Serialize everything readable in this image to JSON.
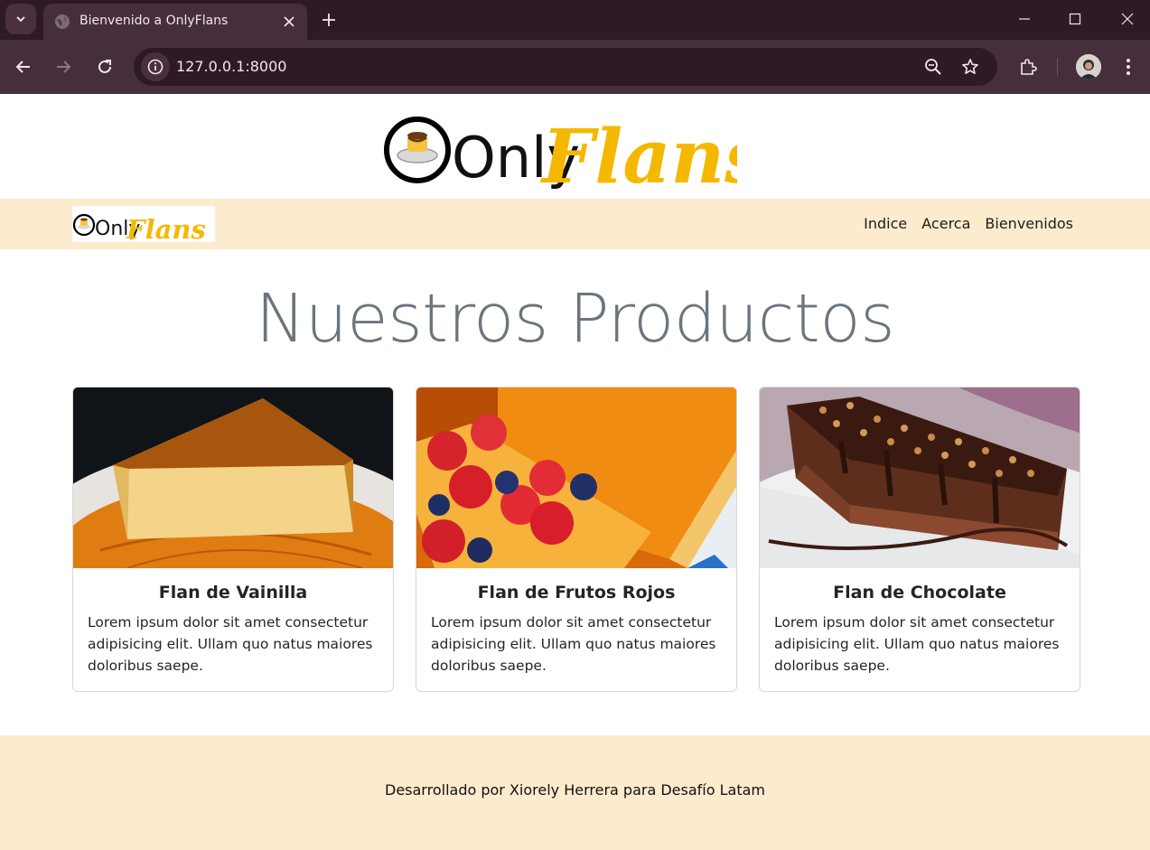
{
  "browser": {
    "tab_title": "Bienvenido a OnlyFlans",
    "url": "127.0.0.1:8000"
  },
  "brand": {
    "logo_text_1": "Only",
    "logo_text_2": "Flans",
    "accent_color": "#f5b800",
    "navbar_bg": "#fdebcd"
  },
  "nav": {
    "links": [
      "Indice",
      "Acerca",
      "Bienvenidos"
    ]
  },
  "main": {
    "heading": "Nuestros Productos",
    "cards": [
      {
        "title": "Flan de Vainilla",
        "text": "Lorem ipsum dolor sit amet consectetur adipisicing elit. Ullam quo natus maiores doloribus saepe."
      },
      {
        "title": "Flan de Frutos Rojos",
        "text": "Lorem ipsum dolor sit amet consectetur adipisicing elit. Ullam quo natus maiores doloribus saepe."
      },
      {
        "title": "Flan de Chocolate",
        "text": "Lorem ipsum dolor sit amet consectetur adipisicing elit. Ullam quo natus maiores doloribus saepe."
      }
    ]
  },
  "footer": {
    "text": "Desarrollado por Xiorely Herrera para Desafío Latam"
  }
}
